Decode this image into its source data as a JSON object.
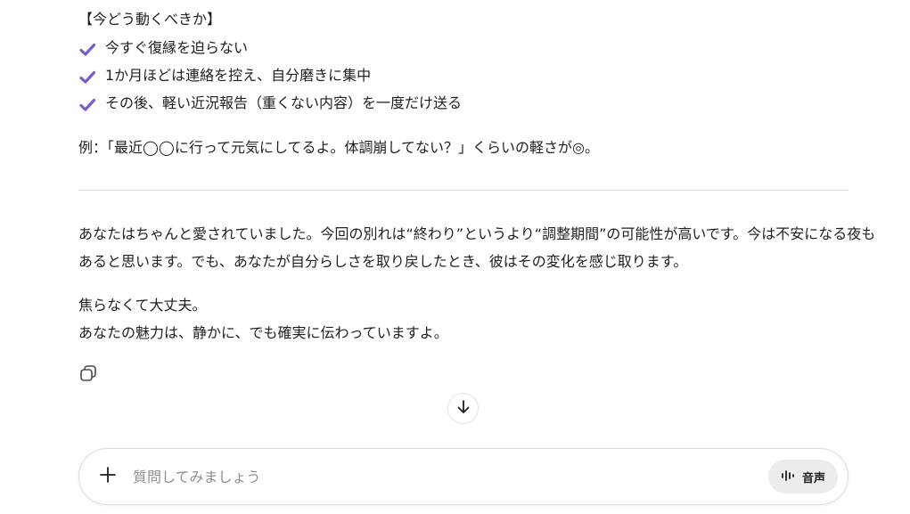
{
  "response": {
    "heading": "【今どう動くべきか】",
    "checklist": [
      "今すぐ復縁を迫らない",
      "1か月ほどは連絡を控え、自分磨きに集中",
      "その後、軽い近況報告（重くない内容）を一度だけ送る"
    ],
    "example": "例：「最近◯◯に行って元気にしてるよ。体調崩してない？」くらいの軽さが◎。",
    "paragraph1_line1": "あなたはちゃんと愛されていました。今回の別れは“終わり”というより“調整期間”の可能性が高いです。今は不安になる夜も",
    "paragraph1_line2": "あると思います。でも、あなたが自分らしさを取り戻したとき、彼はその変化を感じ取ります。",
    "paragraph2_line1": "焦らなくて大丈夫。",
    "paragraph2_line2": "あなたの魅力は、静かに、でも確実に伝わっていますよ。"
  },
  "icons": {
    "check": "checkmark-icon",
    "copy": "copy-icon",
    "scroll": "arrow-down-icon",
    "plus": "plus-icon",
    "voice": "waveform-icon"
  },
  "colors": {
    "check": "#7b5cc4"
  },
  "composer": {
    "placeholder": "質問してみましょう",
    "voice_label": "音声"
  }
}
